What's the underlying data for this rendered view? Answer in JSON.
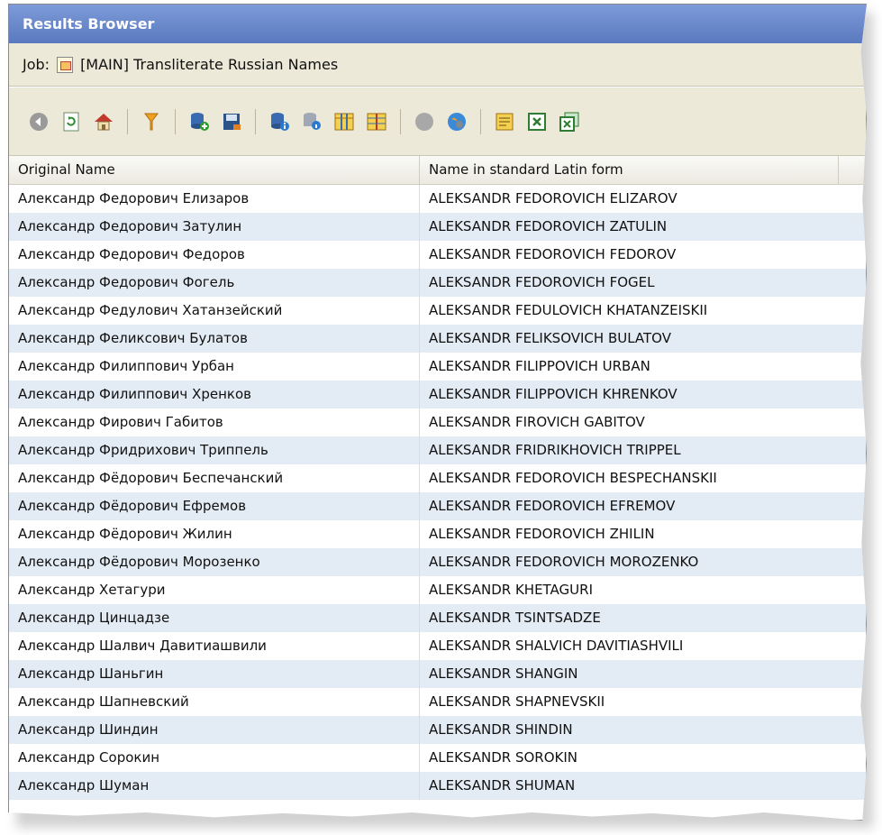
{
  "window": {
    "title": "Results Browser"
  },
  "job": {
    "label": "Job:",
    "name": "[MAIN] Transliterate Russian Names"
  },
  "toolbar": {
    "buttons": [
      {
        "icon": "back-icon"
      },
      {
        "icon": "refresh-icon"
      },
      {
        "icon": "home-icon"
      },
      {
        "icon": "filter-icon"
      },
      {
        "icon": "database-add-icon"
      },
      {
        "icon": "database-save-icon"
      },
      {
        "icon": "database-info-icon"
      },
      {
        "icon": "database-search-icon"
      },
      {
        "icon": "columns-icon"
      },
      {
        "icon": "columns-alt-icon"
      },
      {
        "icon": "stop-icon"
      },
      {
        "icon": "globe-icon"
      },
      {
        "icon": "export-icon"
      },
      {
        "icon": "excel-icon"
      },
      {
        "icon": "excel-multi-icon"
      }
    ]
  },
  "table": {
    "columns": [
      "Original Name",
      "Name in standard Latin form"
    ],
    "rows": [
      [
        "Александр Федорович Елизаров",
        "ALEKSANDR FEDOROVICH ELIZAROV"
      ],
      [
        "Александр Федорович Затулин",
        "ALEKSANDR FEDOROVICH ZATULIN"
      ],
      [
        "Александр Федорович Федоров",
        "ALEKSANDR FEDOROVICH FEDOROV"
      ],
      [
        "Александр Федорович Фогель",
        "ALEKSANDR FEDOROVICH FOGEL"
      ],
      [
        "Александр Федулович Хатанзейский",
        "ALEKSANDR FEDULOVICH KHATANZEISKII"
      ],
      [
        "Александр Феликсович Булатов",
        "ALEKSANDR FELIKSOVICH BULATOV"
      ],
      [
        "Александр Филиппович Урбан",
        "ALEKSANDR FILIPPOVICH URBAN"
      ],
      [
        "Александр Филиппович Хренков",
        "ALEKSANDR FILIPPOVICH KHRENKOV"
      ],
      [
        "Александр Фирович Габитов",
        "ALEKSANDR FIROVICH GABITOV"
      ],
      [
        "Александр Фридрихович Триппель",
        "ALEKSANDR FRIDRIKHOVICH TRIPPEL"
      ],
      [
        "Александр Фёдорович Беспечанский",
        "ALEKSANDR FEDOROVICH BESPECHANSKII"
      ],
      [
        "Александр Фёдорович Ефремов",
        "ALEKSANDR FEDOROVICH EFREMOV"
      ],
      [
        "Александр Фёдорович Жилин",
        "ALEKSANDR FEDOROVICH ZHILIN"
      ],
      [
        "Александр Фёдорович Морозенко",
        "ALEKSANDR FEDOROVICH MOROZENKO"
      ],
      [
        "Александр Хетагури",
        "ALEKSANDR KHETAGURI"
      ],
      [
        "Александр Цинцадзе",
        "ALEKSANDR TSINTSADZE"
      ],
      [
        "Александр Шалвич Давитиашвили",
        "ALEKSANDR SHALVICH DAVITIASHVILI"
      ],
      [
        "Александр Шаньгин",
        "ALEKSANDR SHANGIN"
      ],
      [
        "Александр Шапневский",
        "ALEKSANDR SHAPNEVSKII"
      ],
      [
        "Александр Шиндин",
        "ALEKSANDR SHINDIN"
      ],
      [
        "Александр Сорокин",
        "ALEKSANDR SOROKIN"
      ],
      [
        "Александр Шуман",
        "ALEKSANDR SHUMAN"
      ]
    ]
  },
  "colors": {
    "titlebar": "#5a79bf",
    "chrome": "#ece9d8",
    "row_alt": "#e3ebf4"
  }
}
